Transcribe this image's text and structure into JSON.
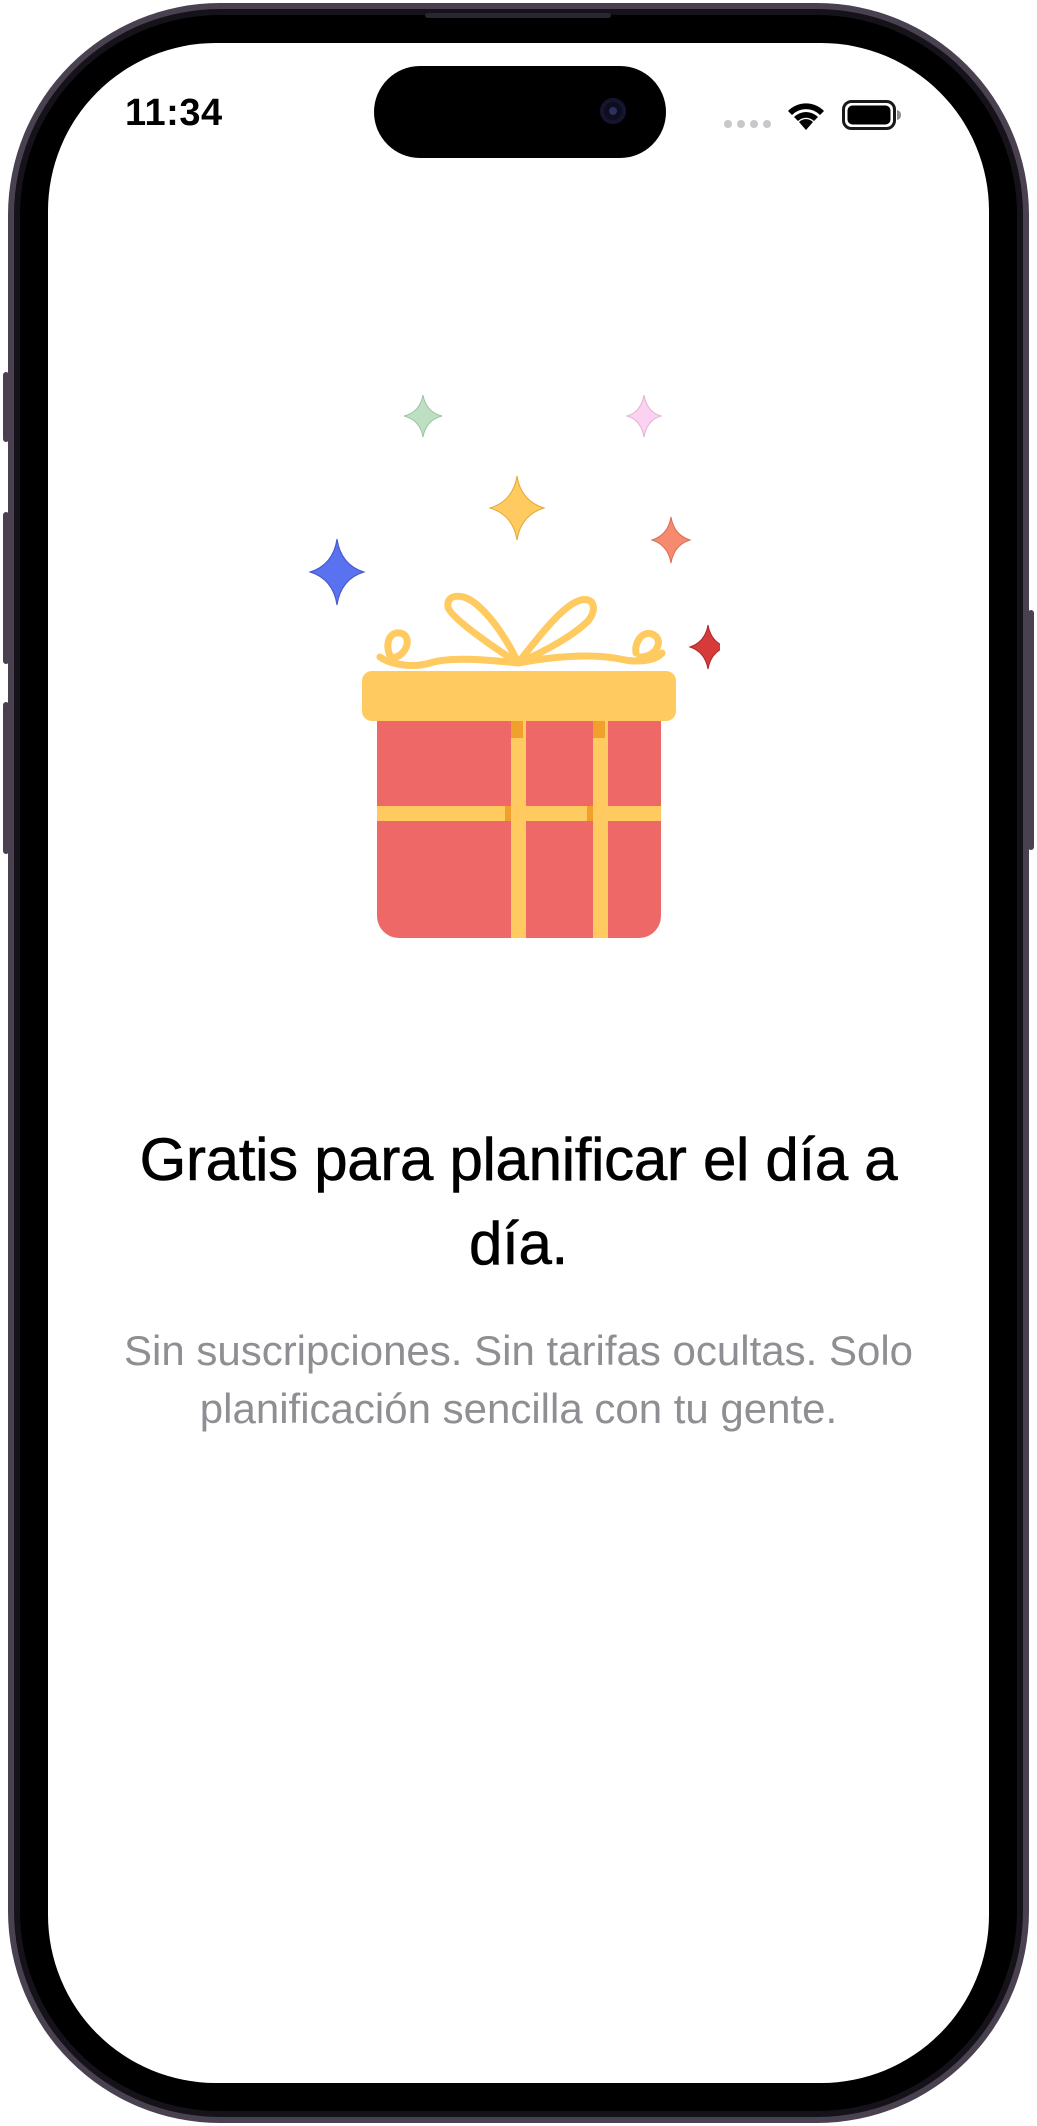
{
  "status_bar": {
    "time": "11:34"
  },
  "onboarding": {
    "headline": "Gratis para planificar el día a día.",
    "subtitle": "Sin suscripciones. Sin tarifas ocultas. Solo planificación sencilla con tu gente.",
    "illustration_icon": "gift-icon"
  },
  "colors": {
    "gift_box": "#EE6868",
    "gift_lid_ribbon": "#FFCA5F",
    "ribbon_shadow": "#F2A02C",
    "sparkle_blue": "#5B72F0",
    "sparkle_yellow": "#FFCA5F",
    "sparkle_green": "#BEE0C2",
    "sparkle_pink": "#FBD2F0",
    "sparkle_orange": "#F58A6E",
    "sparkle_red": "#D63A3A",
    "subtitle_text": "#8E8E93"
  }
}
